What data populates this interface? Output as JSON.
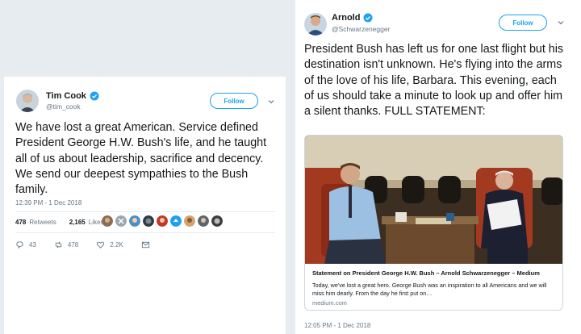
{
  "left_tweet": {
    "name": "Tim Cook",
    "handle": "@tim_cook",
    "follow_label": "Follow",
    "text": "We have lost a great American. Service defined President George H.W. Bush's life, and he taught all of us about leadership, sacrifice and decency. We send our deepest sympathies to the Bush family.",
    "timestamp": "12:39 PM - 1 Dec 2018",
    "retweets_count": "478",
    "retweets_label": "Retweets",
    "likes_count": "2,165",
    "likes_label": "Likes",
    "reply_count": "43",
    "retweet_count": "478",
    "like_count": "2.2K"
  },
  "right_tweet": {
    "name": "Arnold",
    "handle": "@Schwarzenegger",
    "follow_label": "Follow",
    "text": "President Bush has left us for one last flight but his destination isn't unknown. He's flying into the arms of the love of his life, Barbara. This evening, each of us should take a minute to look up and offer him a silent thanks. FULL STATEMENT:",
    "timestamp": "12:05 PM - 1 Dec 2018",
    "card": {
      "title": "Statement on President George H.W. Bush – Arnold Schwarzenegger – Medium",
      "description": "Today, we've lost a great hero. George Bush was an inspiration to all Americans and we will miss him dearly. From the day he first put on…",
      "domain": "medium.com"
    }
  },
  "colors": {
    "accent": "#1da1f2",
    "text": "#14171a",
    "muted": "#657786",
    "background": "#e6ecf0"
  },
  "icons": [
    "verified-badge-icon",
    "chevron-down-icon",
    "reply-icon",
    "retweet-icon",
    "like-icon",
    "share-icon"
  ]
}
